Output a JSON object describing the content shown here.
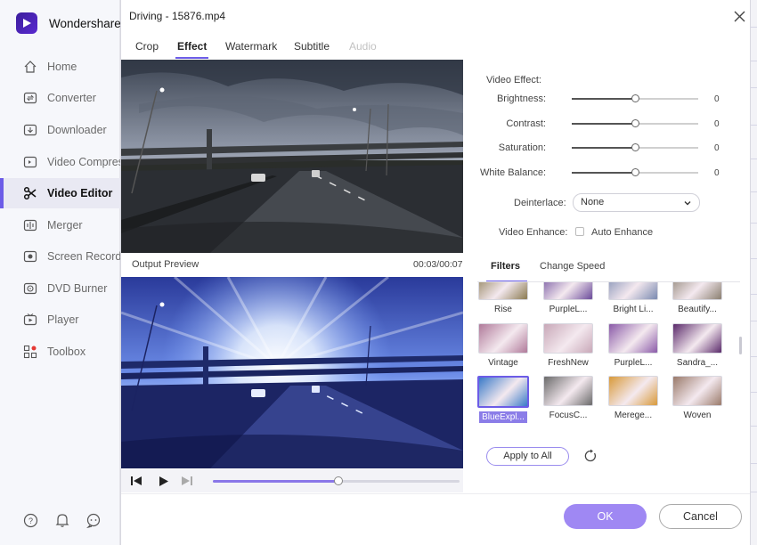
{
  "app": {
    "name": "Wondershare U"
  },
  "sidebar": {
    "items": [
      {
        "label": "Home",
        "icon": "home-icon"
      },
      {
        "label": "Converter",
        "icon": "converter-icon"
      },
      {
        "label": "Downloader",
        "icon": "downloader-icon"
      },
      {
        "label": "Video Compres",
        "icon": "compress-icon"
      },
      {
        "label": "Video Editor",
        "icon": "scissors-icon",
        "active": true
      },
      {
        "label": "Merger",
        "icon": "merger-icon"
      },
      {
        "label": "Screen Recorde",
        "icon": "recorder-icon"
      },
      {
        "label": "DVD Burner",
        "icon": "dvd-icon"
      },
      {
        "label": "Player",
        "icon": "player-icon"
      },
      {
        "label": "Toolbox",
        "icon": "toolbox-icon"
      }
    ],
    "footer_icons": [
      "help-icon",
      "bell-icon",
      "feedback-icon"
    ]
  },
  "dialog": {
    "title": "Driving - 15876.mp4",
    "tabs": [
      {
        "label": "Crop"
      },
      {
        "label": "Effect",
        "active": true
      },
      {
        "label": "Watermark"
      },
      {
        "label": "Subtitle"
      },
      {
        "label": "Audio",
        "disabled": true
      }
    ],
    "preview": {
      "label": "Output Preview",
      "time": "00:03/00:07",
      "progress": 0.51
    },
    "video_effect": {
      "heading": "Video Effect:",
      "sliders": [
        {
          "label": "Brightness:",
          "value": "0",
          "level": 0.5
        },
        {
          "label": "Contrast:",
          "value": "0",
          "level": 0.5
        },
        {
          "label": "Saturation:",
          "value": "0",
          "level": 0.5
        },
        {
          "label": "White Balance:",
          "value": "0",
          "level": 0.5
        }
      ],
      "deinterlace": {
        "label": "Deinterlace:",
        "value": "None"
      },
      "enhance": {
        "label": "Video Enhance:",
        "option": "Auto Enhance",
        "checked": false
      }
    },
    "filter_tabs": {
      "filters": "Filters",
      "speed": "Change Speed"
    },
    "filters": [
      {
        "name": "Rise",
        "tone": "#8a7a50"
      },
      {
        "name": "PurpleL...",
        "tone": "#6a4a9a"
      },
      {
        "name": "Bright Li...",
        "tone": "#7a8ab0"
      },
      {
        "name": "Beautify...",
        "tone": "#8a7f70"
      },
      {
        "name": "Vintage",
        "tone": "#b07a9a"
      },
      {
        "name": "FreshNew",
        "tone": "#c8a8b8"
      },
      {
        "name": "PurpleL...",
        "tone": "#8a5aa8"
      },
      {
        "name": "Sandra_...",
        "tone": "#5a2a6a"
      },
      {
        "name": "BlueExpl...",
        "tone": "#3a7ac8",
        "selected": true
      },
      {
        "name": "FocusC...",
        "tone": "#6a6a6a"
      },
      {
        "name": "Merege...",
        "tone": "#d89a3a"
      },
      {
        "name": "Woven",
        "tone": "#9a7a6a"
      }
    ],
    "apply_all": "Apply to All",
    "ok": "OK",
    "cancel": "Cancel"
  },
  "colors": {
    "accent": "#6c5ce7",
    "ok_button": "#9f88f3"
  }
}
